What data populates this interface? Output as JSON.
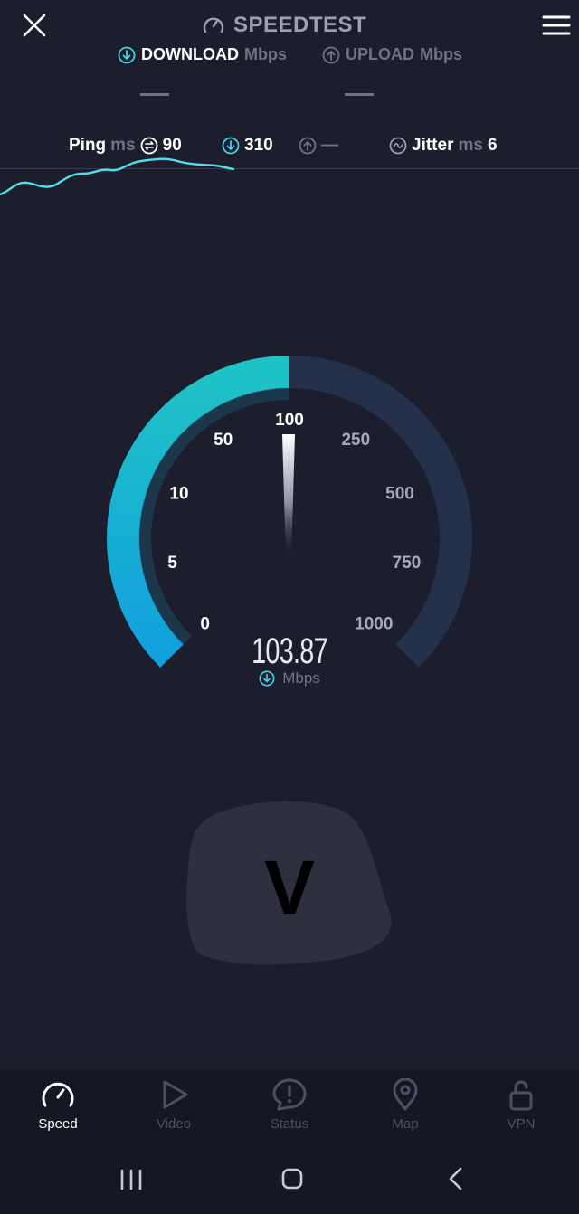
{
  "header": {
    "title": "SPEEDTEST"
  },
  "tabs": {
    "download": {
      "label": "DOWNLOAD",
      "unit": "Mbps"
    },
    "upload": {
      "label": "UPLOAD",
      "unit": "Mbps"
    }
  },
  "stats": {
    "ping_label": "Ping",
    "ping_unit": "ms",
    "ping_idle": "90",
    "ping_download": "310",
    "ping_upload": "—",
    "jitter_label": "Jitter",
    "jitter_unit": "ms",
    "jitter_value": "6"
  },
  "gauge": {
    "ticks": [
      "0",
      "5",
      "10",
      "50",
      "100",
      "250",
      "500",
      "750",
      "1000"
    ],
    "value": "103.87",
    "unit": "Mbps",
    "fill_fraction": 0.5,
    "accent_color": "#1ab6e0"
  },
  "ad_blob": {
    "letter": "V"
  },
  "bottom_nav": [
    {
      "label": "Speed",
      "icon": "speedometer-icon",
      "active": true
    },
    {
      "label": "Video",
      "icon": "play-icon",
      "active": false
    },
    {
      "label": "Status",
      "icon": "alert-icon",
      "active": false
    },
    {
      "label": "Map",
      "icon": "map-pin-icon",
      "active": false
    },
    {
      "label": "VPN",
      "icon": "unlock-icon",
      "active": false
    }
  ],
  "system_nav": {
    "recent": "recent-apps-icon",
    "home": "home-icon",
    "back": "back-icon"
  }
}
